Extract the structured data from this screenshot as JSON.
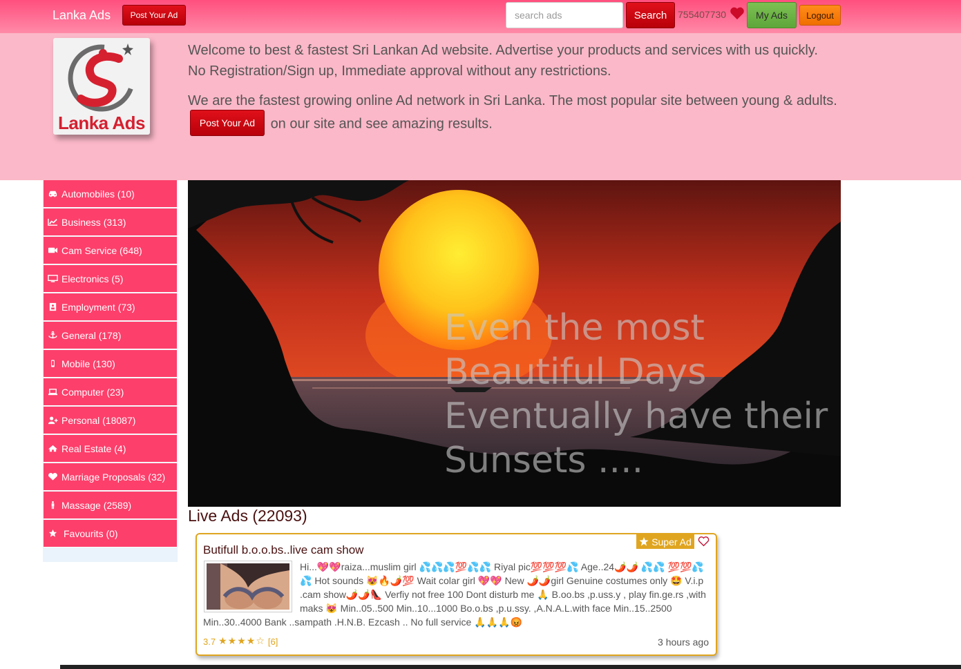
{
  "navbar": {
    "brand": "Lanka Ads",
    "post_label": "Post Your Ad",
    "search_placeholder": "search ads",
    "search_label": "Search",
    "phone": "755407730",
    "myads_label": "My Ads",
    "logout_label": "Logout"
  },
  "header": {
    "logo_text": "Lanka Ads",
    "welcome_text": "Welcome to best & fastest Sri Lankan Ad website. Advertise your products and services with us quickly. No Registration/Sign up, Immediate approval without any restrictions.",
    "growth_text_before": "We are the fastest growing online Ad network in Sri Lanka. The most popular site between young & adults.",
    "post_label": "Post Your Ad",
    "growth_text_after": "on our site and see amazing results."
  },
  "sidebar": {
    "items": [
      {
        "label": "Automobiles (10)",
        "icon": "car-icon"
      },
      {
        "label": "Business (313)",
        "icon": "chart-icon"
      },
      {
        "label": "Cam Service (648)",
        "icon": "video-camera-icon"
      },
      {
        "label": "Electronics (5)",
        "icon": "monitor-icon"
      },
      {
        "label": "Employment (73)",
        "icon": "id-card-icon"
      },
      {
        "label": "General (178)",
        "icon": "anchor-icon"
      },
      {
        "label": "Mobile (130)",
        "icon": "mobile-phone-icon"
      },
      {
        "label": "Computer (23)",
        "icon": "laptop-icon"
      },
      {
        "label": "Personal (18087)",
        "icon": "user-plus-icon"
      },
      {
        "label": "Real Estate (4)",
        "icon": "home-icon"
      },
      {
        "label": "Marriage Proposals (32)",
        "icon": "heart-icon"
      },
      {
        "label": "Massage (2589)",
        "icon": "person-icon"
      },
      {
        "label": "Favourits (0)",
        "icon": "star-icon"
      }
    ]
  },
  "banner": {
    "quote": "Even the most\nBeautiful Days\nEventually have their\nSunsets ...."
  },
  "live_ads": {
    "title": "Live Ads  (22093)",
    "ad": {
      "badge": "Super Ad",
      "title": "Butifull b.o.o.bs..live cam show",
      "description": "Hi...💖💖raiza...muslim girl 💦💦💦💯💦💦 Riyal pic💯💯💯💦 Age..24🌶️🌶️ 💦💦 💯💯💦💦 Hot sounds 😻🔥🌶️💯 Wait colar girl 💖💖 New 🌶️🌶️girl Genuine costumes only 🤩 V.i.p .cam show🌶️🌶️👠 Verfiy not free 100 Dont disturb me 🙏 B.oo.bs ,p.uss.y , play fin.ge.rs ,with maks 😻 Min..05..500 Min..10...1000 Bo.o.bs ,p.u.ssy. ,A.N.A.L.with face Min..15..2500 Min..30..4000 Bank ..sampath .H.N.B. Ezcash .. No full service 🙏🙏🙏😡",
      "rating_value": "3.7",
      "rating_stars": 3.7,
      "rating_count": "[6]",
      "time": "3 hours ago"
    }
  },
  "colors": {
    "navbar_top": "#ff4f7e",
    "header_bg": "#fbb8c8",
    "sidebar_item": "#fd3f6b",
    "accent_red": "#d0101a",
    "gold": "#e0a520"
  }
}
